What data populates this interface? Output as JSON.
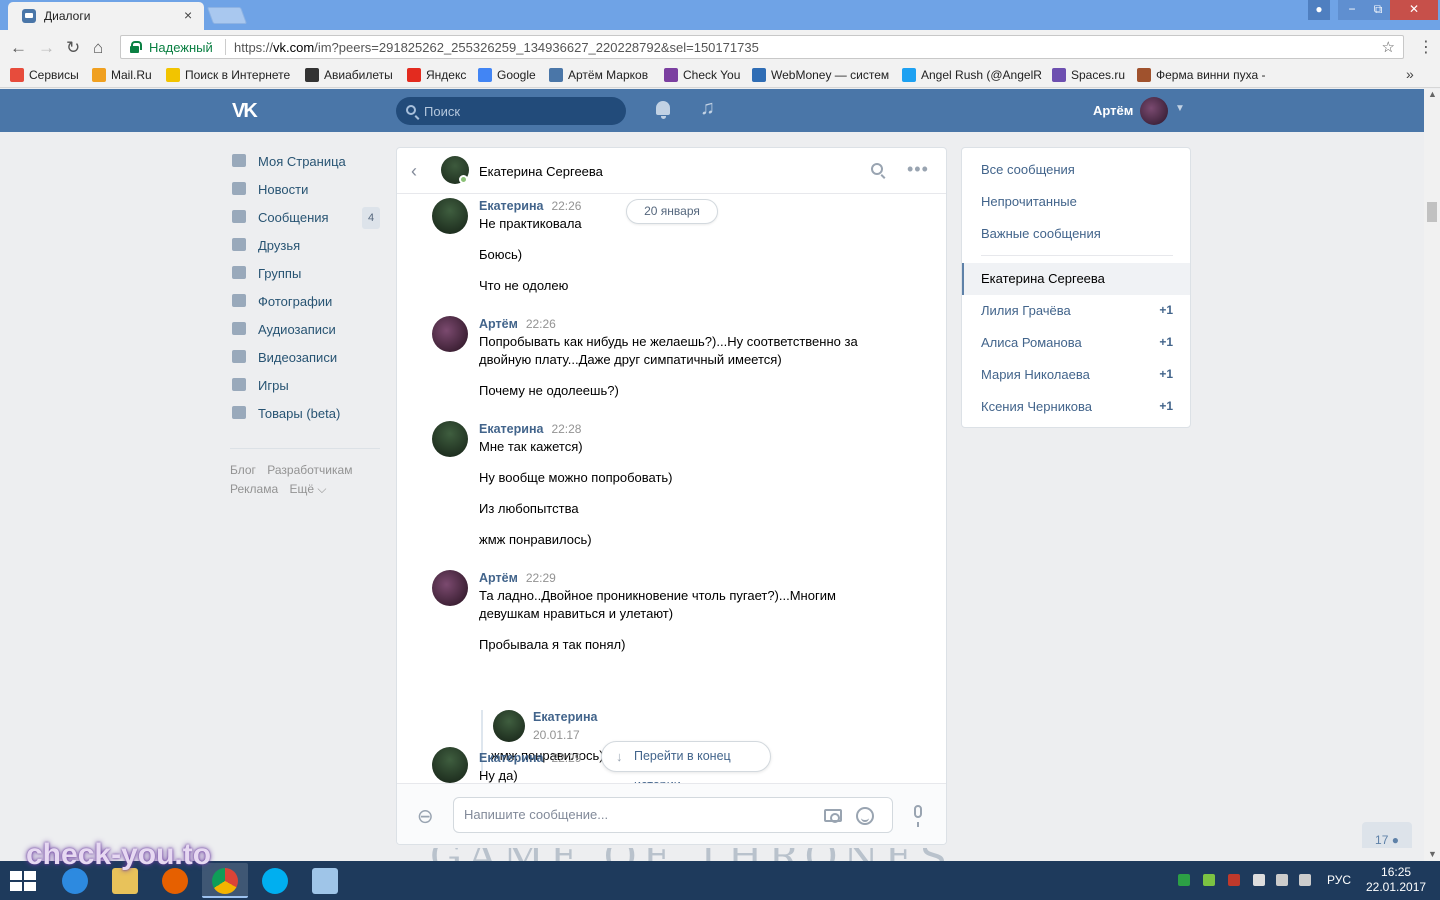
{
  "browser": {
    "tab_title": "Диалоги",
    "tab_close": "×",
    "window_controls": [
      "−",
      "⧉",
      "✕"
    ],
    "secure_label": "Надежный",
    "url_prefix": "https://",
    "url_host": "vk.com",
    "url_path": "/im?peers=291825262_255326259_134936627_220228792&sel=150171735",
    "bookmarks": [
      {
        "label": "Сервисы",
        "color": "#e74c3c"
      },
      {
        "label": "Mail.Ru",
        "color": "#f0a020"
      },
      {
        "label": "Поиск в Интернете",
        "color": "#f2c400"
      },
      {
        "label": "Авиабилеты",
        "color": "#333333"
      },
      {
        "label": "Яндекс",
        "color": "#e32b1f"
      },
      {
        "label": "Google",
        "color": "#4285f4"
      },
      {
        "label": "Артём Марков",
        "color": "#4a76a8"
      },
      {
        "label": "Check You",
        "color": "#7b3fa0"
      },
      {
        "label": "WebMoney — систем",
        "color": "#2f6db5"
      },
      {
        "label": "Angel Rush (@AngelR",
        "color": "#1da1f2"
      },
      {
        "label": "Spaces.ru",
        "color": "#6d4fb0"
      },
      {
        "label": "Ферма винни пуха -",
        "color": "#a0522d"
      }
    ],
    "bookmarks_more": "»"
  },
  "vk_header": {
    "logo": "VK",
    "search_placeholder": "Поиск",
    "user_name": "Артём"
  },
  "left_nav": {
    "items": [
      {
        "label": "Моя Страница",
        "count": ""
      },
      {
        "label": "Новости",
        "count": ""
      },
      {
        "label": "Сообщения",
        "count": "4"
      },
      {
        "label": "Друзья",
        "count": ""
      },
      {
        "label": "Группы",
        "count": ""
      },
      {
        "label": "Фотографии",
        "count": ""
      },
      {
        "label": "Аудиозаписи",
        "count": ""
      },
      {
        "label": "Видеозаписи",
        "count": ""
      },
      {
        "label": "Игры",
        "count": ""
      },
      {
        "label": "Товары (beta)",
        "count": ""
      }
    ],
    "footer": [
      "Блог",
      "Разработчикам",
      "Реклама",
      "Ещё ⌵"
    ]
  },
  "chat": {
    "contact_name": "Екатерина Сергеева",
    "date_separator": "20 января",
    "messages": [
      {
        "author": "Екатерина",
        "time": "22:26",
        "lines": [
          "Не практиковала",
          "Боюсь)",
          "Что не одолею"
        ]
      },
      {
        "author": "Артём",
        "time": "22:26",
        "lines": [
          "Попробывать как нибудь не желаешь?)...Ну соответственно за двойную плату...Даже друг симпатичный имеется)",
          "Почему не одолеешь?)"
        ]
      },
      {
        "author": "Екатерина",
        "time": "22:28",
        "lines": [
          "Мне так кажется)",
          "Ну вообще можно попробовать)",
          "Из любопытства",
          "жмж понравилось)"
        ]
      },
      {
        "author": "Артём",
        "time": "22:29",
        "lines": [
          "Та ладно..Двойное проникновение чтоль пугает?)...Многим девушкам нравиться и улетают)",
          "Пробывала я так понял)"
        ]
      },
      {
        "author": "Екатерина",
        "time": "22:29",
        "lines": [
          "Ну да)"
        ]
      }
    ],
    "forwarded": {
      "author": "Екатерина",
      "date": "20.01.17",
      "text": "жмж понравилось)"
    },
    "jump_label": "Перейти в конец истории",
    "composer_placeholder": "Напишите сообщение..."
  },
  "right_panel": {
    "filters": [
      "Все сообщения",
      "Непрочитанные",
      "Важные сообщения"
    ],
    "active": "Екатерина Сергеева",
    "conversations": [
      {
        "name": "Лилия Грачёва",
        "count": "+1"
      },
      {
        "name": "Алиса Романова",
        "count": "+1"
      },
      {
        "name": "Мария Николаева",
        "count": "+1"
      },
      {
        "name": "Ксения Черникова",
        "count": "+1"
      }
    ]
  },
  "online_badge": "17",
  "wallpaper_text": "GAME OF THRONES",
  "taskbar": {
    "lang": "РУС",
    "time": "16:25",
    "date": "22.01.2017"
  },
  "watermark": "check-you.to",
  "colors": {
    "vk_blue": "#4a76a8",
    "link": "#42648b",
    "taskbar": "#1e3a5c"
  }
}
